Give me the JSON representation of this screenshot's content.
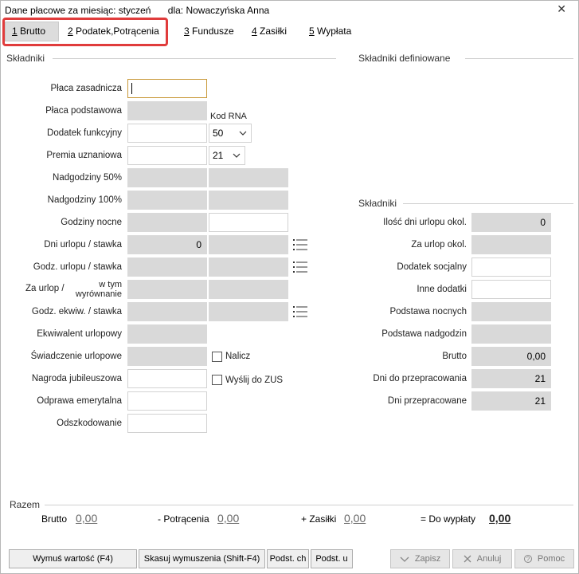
{
  "window": {
    "title": "Dane płacowe za miesiąc: styczeń",
    "for_label": "dla: Nowaczyńska Anna",
    "close_glyph": "✕"
  },
  "tabs": [
    {
      "num": "1",
      "label": "Brutto",
      "active": true
    },
    {
      "num": "2",
      "label": "Podatek,Potrącenia",
      "active": false
    },
    {
      "num": "3",
      "label": "Fundusze",
      "active": false
    },
    {
      "num": "4",
      "label": "Zasiłki",
      "active": false
    },
    {
      "num": "5",
      "label": "Wypłata",
      "active": false
    }
  ],
  "left_section": {
    "title": "Składniki",
    "kod_rna_label": "Kod RNA",
    "placa_zasadnicza": {
      "label": "Płaca zasadnicza",
      "value": ""
    },
    "placa_podstawowa": {
      "label": "Płaca podstawowa",
      "value": ""
    },
    "dodatek_funkcyjny": {
      "label": "Dodatek funkcyjny",
      "value": "",
      "code": "50"
    },
    "premia_uznaniowa": {
      "label": "Premia uznaniowa",
      "value": "",
      "code": "21"
    },
    "nadgodziny_50": {
      "label": "Nadgodziny 50%",
      "value": "",
      "value2": ""
    },
    "nadgodziny_100": {
      "label": "Nadgodziny 100%",
      "value": "",
      "value2": ""
    },
    "godziny_nocne": {
      "label": "Godziny nocne",
      "value": "",
      "value2": ""
    },
    "dni_urlopu": {
      "label": "Dni urlopu / stawka",
      "value": "0",
      "value2": ""
    },
    "godz_urlopu": {
      "label": "Godz. urlopu / stawka",
      "value": "",
      "value2": ""
    },
    "za_urlop": {
      "label": "Za urlop /",
      "label2": "w tym",
      "label3": "wyrównanie",
      "value": "",
      "value2": ""
    },
    "godz_ekwiw": {
      "label": "Godz. ekwiw. / stawka",
      "value": "",
      "value2": ""
    },
    "ekwiwalent": {
      "label": "Ekwiwalent urlopowy",
      "value": ""
    },
    "swiadczenie": {
      "label": "Świadczenie urlopowe",
      "value": "",
      "checkbox": "Nalicz"
    },
    "nagroda": {
      "label": "Nagroda jubileuszowa",
      "value": "",
      "checkbox": "Wyślij do ZUS"
    },
    "odprawa": {
      "label": "Odprawa emerytalna",
      "value": ""
    },
    "odszkodowanie": {
      "label": "Odszkodowanie",
      "value": ""
    }
  },
  "right_section": {
    "title_defined": "Składniki definiowane",
    "title": "Składniki",
    "rows": [
      {
        "label": "Ilość dni urlopu okol.",
        "value": "0",
        "readonly": true
      },
      {
        "label": "Za urlop okol.",
        "value": "",
        "readonly": true
      },
      {
        "label": "Dodatek socjalny",
        "value": "",
        "readonly": false
      },
      {
        "label": "Inne dodatki",
        "value": "",
        "readonly": false
      },
      {
        "label": "Podstawa nocnych",
        "value": "",
        "readonly": true
      },
      {
        "label": "Podstawa nadgodzin",
        "value": "",
        "readonly": true
      },
      {
        "label": "Brutto",
        "value": "0,00",
        "readonly": true
      },
      {
        "label": "Dni do przepracowania",
        "value": "21",
        "readonly": true
      },
      {
        "label": "Dni przepracowane",
        "value": "21",
        "readonly": true
      }
    ]
  },
  "razem": {
    "title": "Razem",
    "brutto_label": "Brutto",
    "brutto_value": "0,00",
    "potracenia_label": "- Potrącenia",
    "potracenia_value": "0,00",
    "zasilki_label": "+ Zasiłki",
    "zasilki_value": "0,00",
    "do_wyplaty_label": "= Do wypłaty",
    "do_wyplaty_value": "0,00"
  },
  "buttons": {
    "wymus": "Wymuś wartość (F4)",
    "skasuj": "Skasuj wymuszenia (Shift-F4)",
    "podst_ch": "Podst. ch",
    "podst_u": "Podst. u",
    "zapisz": "Zapisz",
    "anuluj": "Anuluj",
    "pomoc": "Pomoc"
  }
}
